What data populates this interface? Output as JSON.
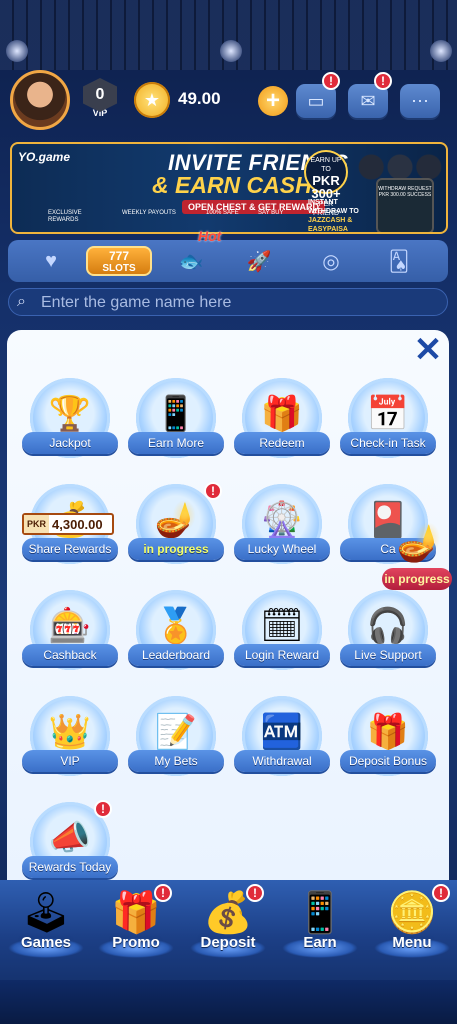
{
  "header": {
    "avatar_icon": "user-avatar",
    "vip_label": "VIP",
    "vip_level": "0",
    "balance": "49.00",
    "add_icon": "plus-icon",
    "wallet_alert": "!",
    "mail_alert": "!"
  },
  "banner": {
    "brand": "YO.game",
    "title_line1": "INVITE FRIENDS",
    "title_line2": "& EARN CASH!",
    "subtitle": "OPEN CHEST & GET REWARD",
    "badge_top": "EARN UP TO",
    "badge_amount": "PKR 300+",
    "badge_bottom": "PER FRIEND",
    "feature1": "EXCLUSIVE REWARDS",
    "feature2": "WEEKLY PAYOUTS",
    "feature3": "100% SAFE",
    "feature4": "SAY BUY",
    "withdraw_text": "INSTANT WITHDRAW TO",
    "withdraw_methods": "JAZZCASH & EASYPAISA",
    "phone_text": "WITHDRAW REQUEST PKR 300.00 SUCCESS"
  },
  "categories": {
    "hot_label": "Hot",
    "slots_label": "SLOTS"
  },
  "search": {
    "placeholder": "Enter the game name here"
  },
  "menu": {
    "items": [
      {
        "label": "Jackpot",
        "icon": "trophy-icon"
      },
      {
        "label": "Earn More",
        "icon": "phone-coins-icon"
      },
      {
        "label": "Redeem",
        "icon": "code-gift-icon"
      },
      {
        "label": "Check-in Task",
        "icon": "calendar-check-icon"
      },
      {
        "label": "Share Rewards",
        "icon": "treasure-chest-icon"
      },
      {
        "label": "in progress",
        "icon": "magic-lamp-icon"
      },
      {
        "label": "Lucky Wheel",
        "icon": "wheel-icon"
      },
      {
        "label": "Ca",
        "icon": "card-gift-icon"
      },
      {
        "label": "Cashback",
        "icon": "cashback-machine-icon"
      },
      {
        "label": "Leaderboard",
        "icon": "podium-icon"
      },
      {
        "label": "Login Reward",
        "icon": "calendar-coins-icon"
      },
      {
        "label": "Live Support",
        "icon": "support-agent-icon"
      },
      {
        "label": "VIP",
        "icon": "crown-chest-icon"
      },
      {
        "label": "My Bets",
        "icon": "bet-slip-icon"
      },
      {
        "label": "Withdrawal",
        "icon": "atm-icon"
      },
      {
        "label": "Deposit Bonus",
        "icon": "gift-box-icon"
      },
      {
        "label": "Rewards Today",
        "icon": "megaphone-gift-icon"
      }
    ],
    "share_currency": "PKR",
    "share_amount": "4,300.00",
    "floating_label": "in progress",
    "alert_mark": "!"
  },
  "bottom_nav": [
    {
      "label": "Games",
      "icon": "joystick-icon"
    },
    {
      "label": "Promo",
      "icon": "gift-icon"
    },
    {
      "label": "Deposit",
      "icon": "coin-chest-icon"
    },
    {
      "label": "Earn",
      "icon": "phone-coins-icon"
    },
    {
      "label": "Menu",
      "icon": "menu-treasure-icon"
    }
  ]
}
